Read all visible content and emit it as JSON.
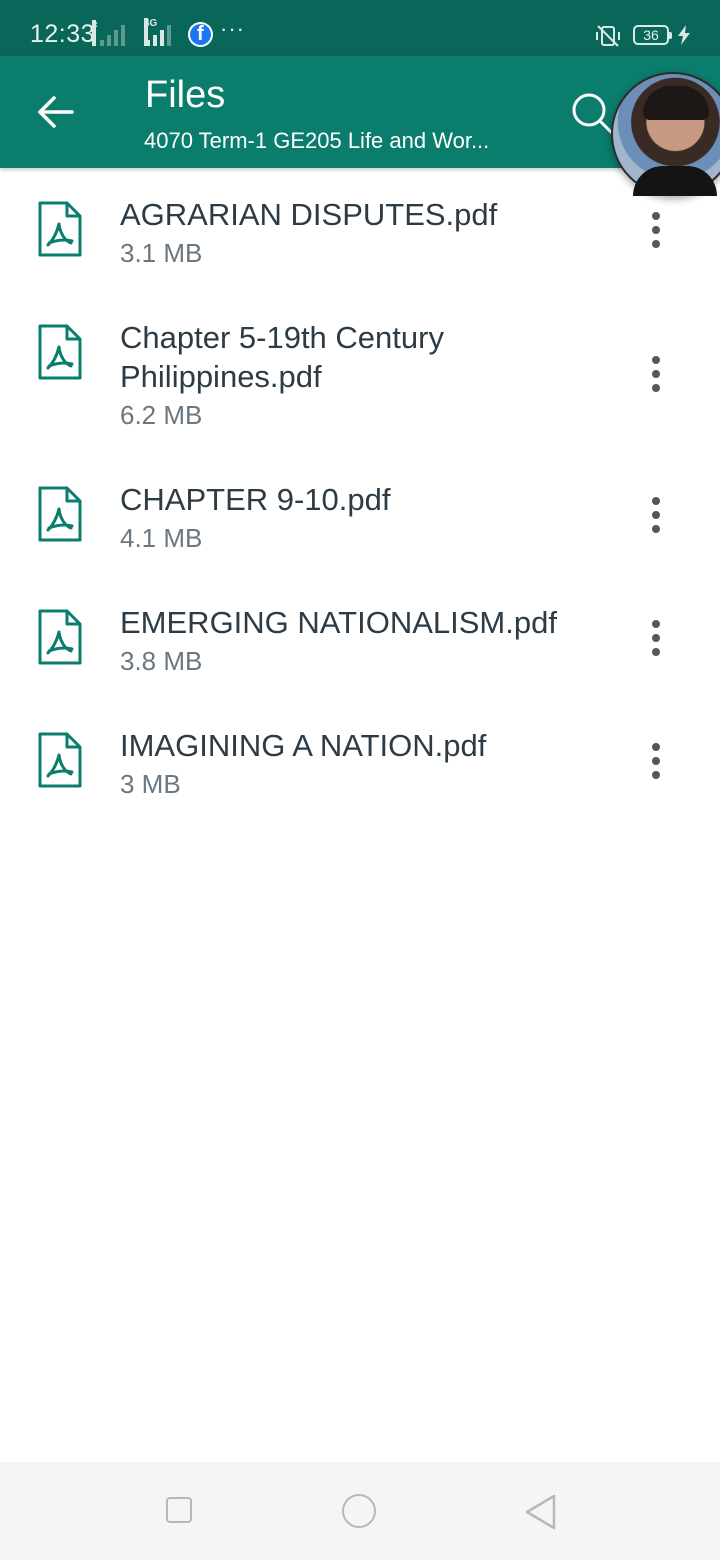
{
  "status_bar": {
    "time": "12:33",
    "signal_1_tag": "×",
    "signal_2_tag": "4G",
    "more": "···",
    "battery_level": "36",
    "icons": [
      "signal-x-icon",
      "signal-4g-icon",
      "facebook-icon",
      "vibrate-mute-icon",
      "battery-icon",
      "charging-icon"
    ]
  },
  "app_bar": {
    "title": "Files",
    "subtitle": "4070  Term-1 GE205 Life and Wor...",
    "back_icon": "arrow-left-icon",
    "search_icon": "search-icon",
    "color": "#0b7d6c"
  },
  "files": [
    {
      "name": "AGRARIAN DISPUTES.pdf",
      "size": "3.1 MB"
    },
    {
      "name": "Chapter 5-19th Century Philippines.pdf",
      "size": "6.2 MB"
    },
    {
      "name": "CHAPTER 9-10.pdf",
      "size": "4.1 MB"
    },
    {
      "name": "EMERGING NATIONALISM.pdf",
      "size": "3.8 MB"
    },
    {
      "name": "IMAGINING A NATION.pdf",
      "size": "3 MB"
    }
  ],
  "nav_bar": {
    "icons": [
      "recents-square-icon",
      "home-circle-icon",
      "back-triangle-icon"
    ]
  }
}
